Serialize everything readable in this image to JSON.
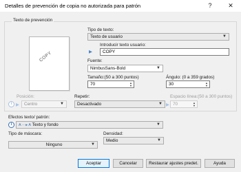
{
  "window": {
    "title": "Detalles de prevención de copia no autorizada para patrón",
    "help_label": "?",
    "close_label": "✕"
  },
  "group": {
    "title": "Texto de prevención",
    "preview_text": "COPY"
  },
  "text_type": {
    "label": "Tipo de texto:",
    "value": "Texto de usuario"
  },
  "user_text": {
    "label": "Introducir texto usuario:",
    "value": "COPY"
  },
  "font": {
    "label": "Fuente:",
    "value": "NimbusSans-Bold"
  },
  "size": {
    "label": "Tamaño:(50 a 300 puntos)",
    "value": "70"
  },
  "angle": {
    "label": "Ángulo: (0 a 359 grados)",
    "value": "30"
  },
  "position": {
    "label": "Posición:",
    "value": "Centro"
  },
  "repeat": {
    "label": "Repetir:",
    "value": "Desactivado"
  },
  "line_space": {
    "label": "Espacio línea:(50 a 300 puntos)",
    "value": "70"
  },
  "effects": {
    "label": "Efectos texto/ patrón:",
    "value": "Texto y fondo"
  },
  "mask": {
    "label": "Tipo de máscara:",
    "value": "Ninguno"
  },
  "density": {
    "label": "Densidad:",
    "value": "Medio"
  },
  "buttons": {
    "ok": "Aceptar",
    "cancel": "Cancelar",
    "reset": "Restaurar ajustes predet.",
    "help": "Ayuda"
  },
  "icons": {
    "spin_up": "▲",
    "spin_down": "▼",
    "dropdown": "▼",
    "arrow": "▶",
    "info": "i",
    "effects": "A ···▸ A"
  },
  "colors": {
    "accent": "#0078d7",
    "arrow": "#4f86c6",
    "dialog_bg": "#f0f0f0"
  }
}
